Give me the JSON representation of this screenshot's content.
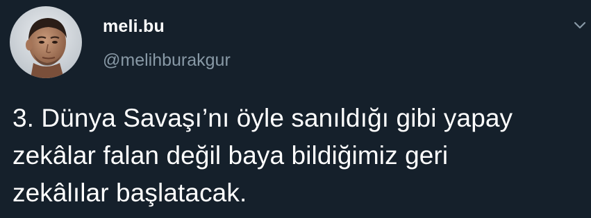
{
  "tweet": {
    "author": {
      "display_name": "meli.bu",
      "handle": "@melihburakgur",
      "avatar_icon": "profile-photo"
    },
    "menu_icon": "chevron-down-icon",
    "text_lines": [
      "3. Dünya Savaşı’nı öyle sanıldığı gibi yapay",
      "zekâlar falan değil baya bildiğimiz geri",
      "zekâlılar başlatacak."
    ]
  },
  "colors": {
    "background": "#15202b",
    "text_primary": "#ffffff",
    "text_secondary": "#8899a6"
  }
}
